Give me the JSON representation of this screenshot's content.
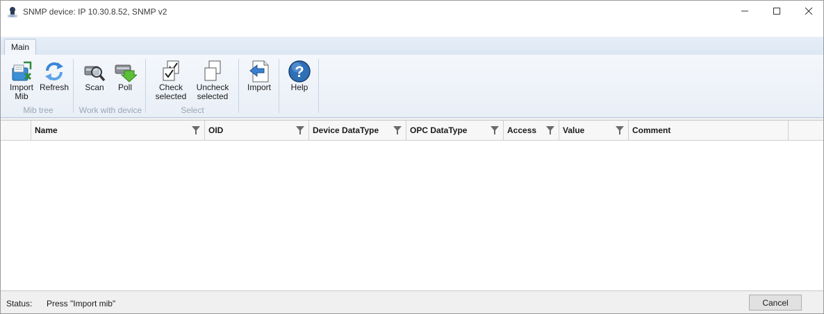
{
  "window": {
    "title": "SNMP device: IP 10.30.8.52, SNMP v2"
  },
  "ribbon": {
    "tabs": [
      {
        "label": "Main"
      }
    ],
    "groups": [
      {
        "label": "Mib tree",
        "buttons": [
          {
            "label": "Import\nMib",
            "icon": "import-mib-icon"
          },
          {
            "label": "Refresh",
            "icon": "refresh-icon"
          }
        ]
      },
      {
        "label": "Work with device",
        "buttons": [
          {
            "label": "Scan",
            "icon": "scan-icon"
          },
          {
            "label": "Poll",
            "icon": "poll-icon"
          }
        ]
      },
      {
        "label": "Select",
        "buttons": [
          {
            "label": "Check\nselected",
            "icon": "check-selected-icon"
          },
          {
            "label": "Uncheck\nselected",
            "icon": "uncheck-selected-icon"
          }
        ]
      },
      {
        "label": "",
        "buttons": [
          {
            "label": "Import",
            "icon": "import-icon"
          }
        ]
      },
      {
        "label": "",
        "buttons": [
          {
            "label": "Help",
            "icon": "help-icon"
          }
        ]
      }
    ]
  },
  "grid": {
    "columns": [
      "Name",
      "OID",
      "Device DataType",
      "OPC DataType",
      "Access",
      "Value",
      "Comment"
    ],
    "rows": []
  },
  "status": {
    "label": "Status:",
    "text": "Press \"Import mib\""
  },
  "buttons": {
    "cancel": "Cancel"
  },
  "colors": {
    "accent": "#2f6fb5",
    "ribbon_bg": "#e9eff7",
    "group_label": "#9aa5b4"
  }
}
